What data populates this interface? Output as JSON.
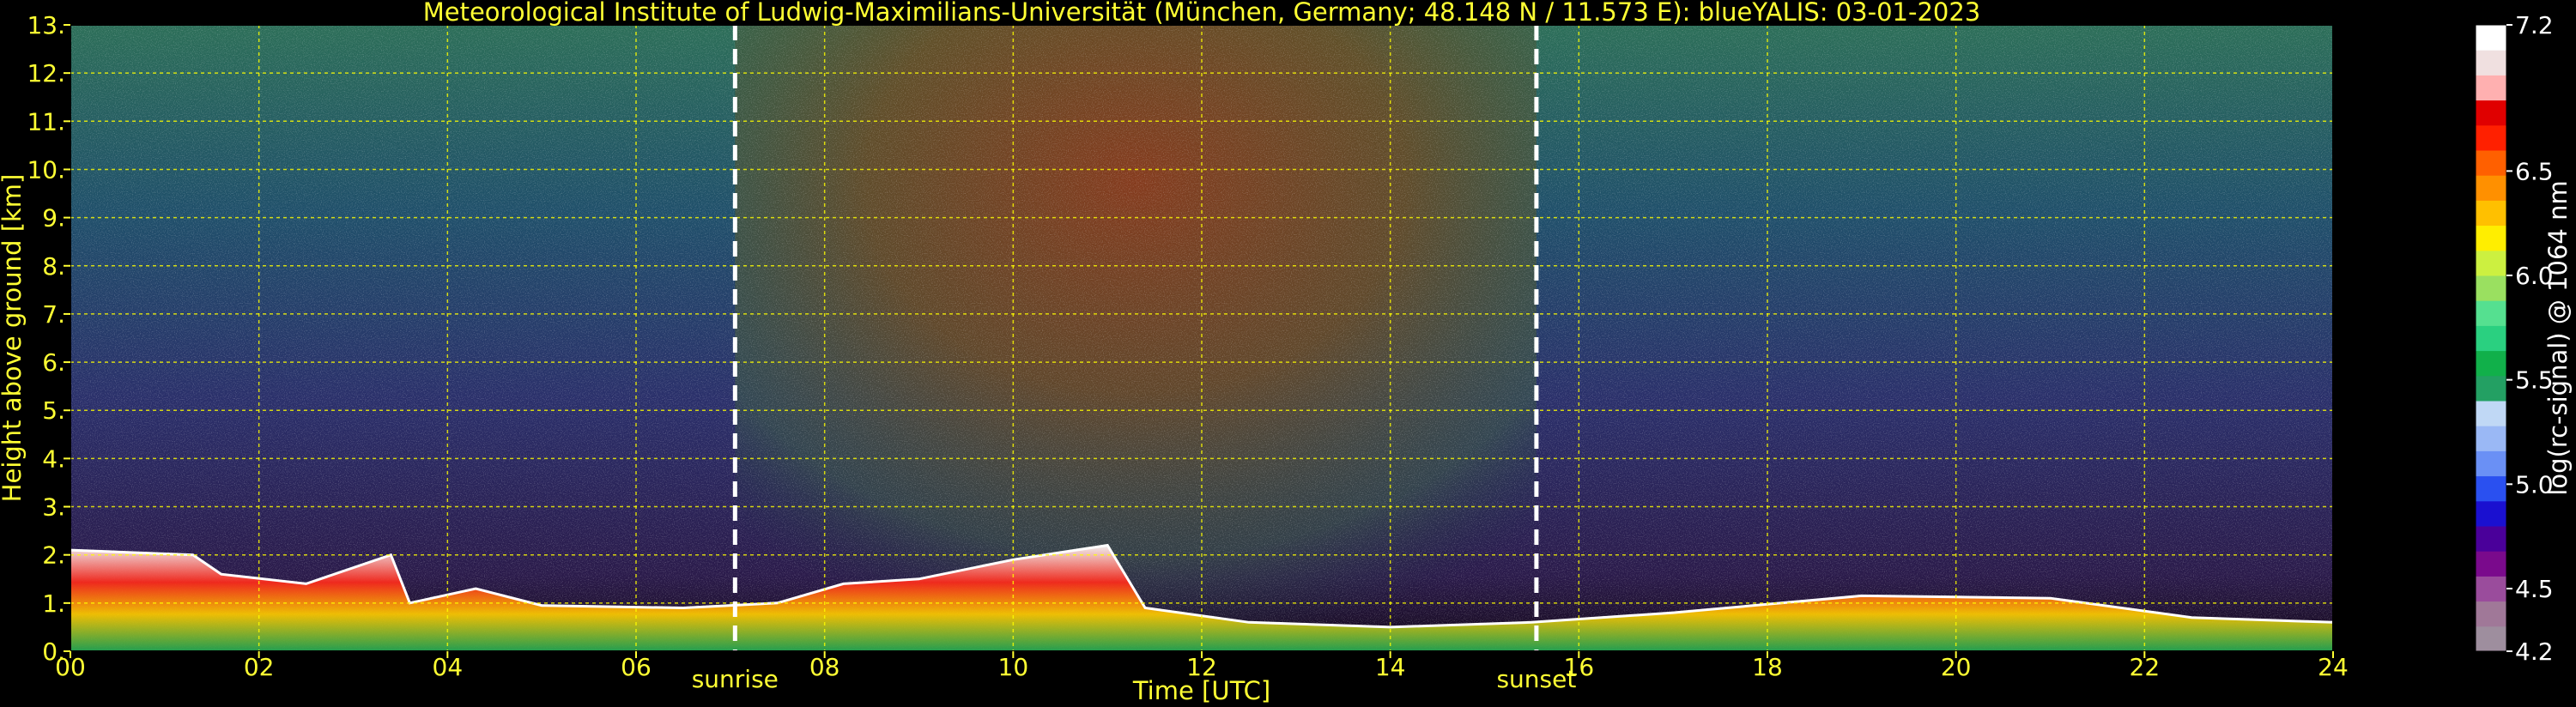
{
  "chart_data": {
    "type": "heatmap",
    "title": "Meteorological Institute of Ludwig-Maximilians-Universität (München, Germany; 48.148 N / 11.573 E):    blueYALIS: 03-01-2023",
    "xlabel": "Time [UTC]",
    "ylabel": "Height above ground [km]",
    "xlim": [
      0,
      24
    ],
    "ylim": [
      0,
      13
    ],
    "x_ticks": [
      {
        "value": 0,
        "label": "00"
      },
      {
        "value": 2,
        "label": "02"
      },
      {
        "value": 4,
        "label": "04"
      },
      {
        "value": 6,
        "label": "06"
      },
      {
        "value": 8,
        "label": "08"
      },
      {
        "value": 10,
        "label": "10"
      },
      {
        "value": 12,
        "label": "12"
      },
      {
        "value": 14,
        "label": "14"
      },
      {
        "value": 16,
        "label": "16"
      },
      {
        "value": 18,
        "label": "18"
      },
      {
        "value": 20,
        "label": "20"
      },
      {
        "value": 22,
        "label": "22"
      },
      {
        "value": 24,
        "label": "24"
      }
    ],
    "y_ticks": [
      {
        "value": 0,
        "label": "0."
      },
      {
        "value": 1,
        "label": "1."
      },
      {
        "value": 2,
        "label": "2."
      },
      {
        "value": 3,
        "label": "3."
      },
      {
        "value": 4,
        "label": "4."
      },
      {
        "value": 5,
        "label": "5."
      },
      {
        "value": 6,
        "label": "6."
      },
      {
        "value": 7,
        "label": "7."
      },
      {
        "value": 8,
        "label": "8."
      },
      {
        "value": 9,
        "label": "9."
      },
      {
        "value": 10,
        "label": "10."
      },
      {
        "value": 11,
        "label": "11."
      },
      {
        "value": 12,
        "label": "12."
      },
      {
        "value": 13,
        "label": "13."
      }
    ],
    "grid": true,
    "grid_color": "#ffff00",
    "events": [
      {
        "label": "sunrise",
        "time": 7.05
      },
      {
        "label": "sunset",
        "time": 15.55
      }
    ],
    "colorbar": {
      "label": "log(rc-signal) @ 1064 nm",
      "range": [
        4.2,
        7.2
      ],
      "ticks": [
        {
          "value": 4.2,
          "label": "4.2"
        },
        {
          "value": 4.5,
          "label": "4.5"
        },
        {
          "value": 5.0,
          "label": "5.0"
        },
        {
          "value": 5.5,
          "label": "5.5"
        },
        {
          "value": 6.0,
          "label": "6.0"
        },
        {
          "value": 6.5,
          "label": "6.5"
        },
        {
          "value": 7.2,
          "label": "7.2"
        }
      ],
      "colors": [
        "#9e8e9e",
        "#a07898",
        "#9a4c9c",
        "#7a0a8c",
        "#4a009a",
        "#1a10d0",
        "#2a50f0",
        "#6a90f5",
        "#9ab8f5",
        "#c0d8f5",
        "#23a063",
        "#11b04a",
        "#2ad080",
        "#55e090",
        "#9ae060",
        "#ccf040",
        "#ffee00",
        "#ffc000",
        "#ff9000",
        "#ff6000",
        "#ff2000",
        "#e00000",
        "#ffb0b0",
        "#f0e0e0",
        "#ffffff"
      ]
    },
    "boundary_layer_top_km": [
      {
        "x": 0.0,
        "y": 2.1
      },
      {
        "x": 1.3,
        "y": 2.0
      },
      {
        "x": 1.6,
        "y": 1.6
      },
      {
        "x": 2.5,
        "y": 1.4
      },
      {
        "x": 3.4,
        "y": 2.0
      },
      {
        "x": 3.6,
        "y": 1.0
      },
      {
        "x": 4.3,
        "y": 1.3
      },
      {
        "x": 5.0,
        "y": 0.95
      },
      {
        "x": 6.5,
        "y": 0.9
      },
      {
        "x": 7.5,
        "y": 1.0
      },
      {
        "x": 8.2,
        "y": 1.4
      },
      {
        "x": 9.0,
        "y": 1.5
      },
      {
        "x": 10.0,
        "y": 1.9
      },
      {
        "x": 11.0,
        "y": 2.2
      },
      {
        "x": 11.4,
        "y": 0.9
      },
      {
        "x": 12.5,
        "y": 0.6
      },
      {
        "x": 14.0,
        "y": 0.5
      },
      {
        "x": 15.5,
        "y": 0.6
      },
      {
        "x": 17.0,
        "y": 0.8
      },
      {
        "x": 19.0,
        "y": 1.15
      },
      {
        "x": 21.0,
        "y": 1.1
      },
      {
        "x": 22.5,
        "y": 0.7
      },
      {
        "x": 24.0,
        "y": 0.6
      }
    ]
  }
}
